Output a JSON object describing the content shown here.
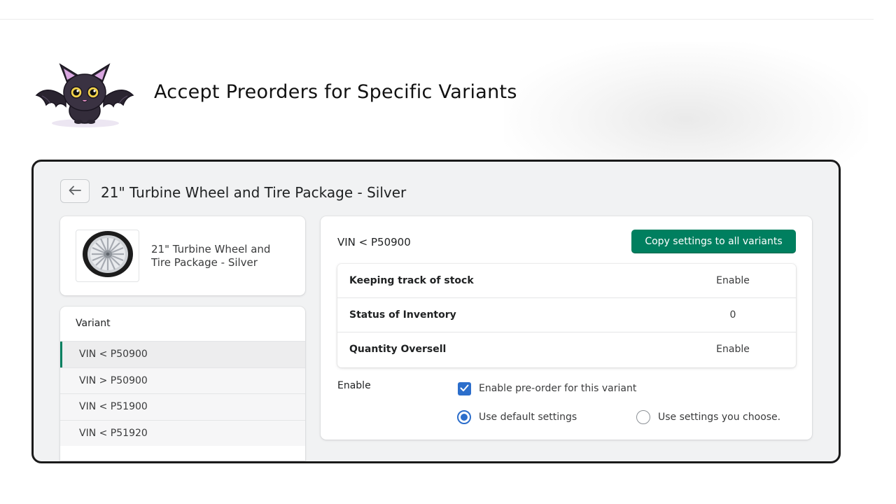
{
  "headline": "Accept Preorders for Specific Variants",
  "product": {
    "title": "21\" Turbine Wheel and Tire Package - Silver",
    "card_name": "21\" Turbine Wheel and Tire Package - Silver"
  },
  "variants": {
    "header": "Variant",
    "items": [
      {
        "label": "VIN < P50900",
        "active": true
      },
      {
        "label": "VIN > P50900",
        "active": false
      },
      {
        "label": "VIN < P51900",
        "active": false
      },
      {
        "label": "VIN < P51920",
        "active": false
      }
    ]
  },
  "settings": {
    "variant_label": "VIN < P50900",
    "copy_button": "Copy settings to all variants",
    "rows": [
      {
        "key": "Keeping track of stock",
        "value": "Enable"
      },
      {
        "key": "Status of Inventory",
        "value": "0"
      },
      {
        "key": "Quantity Oversell",
        "value": "Enable"
      }
    ],
    "enable_label": "Enable",
    "preorder_checkbox": {
      "label": "Enable pre-order for this variant",
      "checked": true
    },
    "radio_default": {
      "label": "Use default settings",
      "selected": true
    },
    "radio_custom": {
      "label": "Use settings you choose.",
      "selected": false
    }
  },
  "colors": {
    "primary_button": "#007f5f",
    "active_indicator": "#008060",
    "checkbox": "#2c6ecb"
  },
  "icons": {
    "back": "arrow-left-icon",
    "mascot": "bat-mascot-icon",
    "thumbnail": "wheel-icon",
    "check": "checkmark-icon"
  }
}
